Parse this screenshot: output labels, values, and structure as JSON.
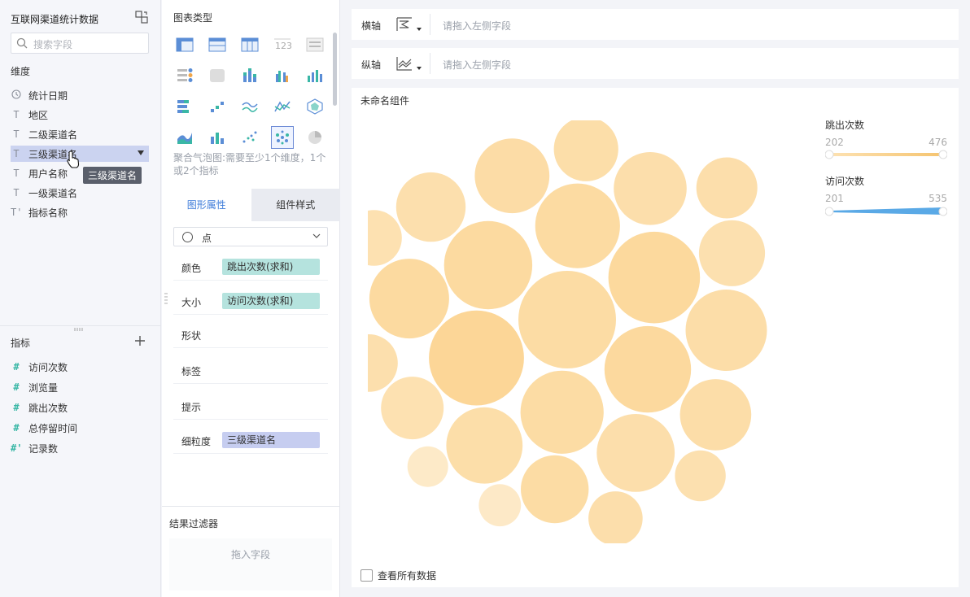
{
  "sidebar": {
    "dataset_title": "互联网渠道统计数据",
    "search_placeholder": "搜索字段",
    "dimensions_label": "维度",
    "dimensions": [
      {
        "icon": "clock",
        "label": "统计日期"
      },
      {
        "icon": "T",
        "label": "地区"
      },
      {
        "icon": "T",
        "label": "二级渠道名"
      },
      {
        "icon": "T",
        "label": "三级渠道名"
      },
      {
        "icon": "T",
        "label": "用户名称"
      },
      {
        "icon": "T",
        "label": "一级渠道名"
      },
      {
        "icon": "T'",
        "label": "指标名称"
      }
    ],
    "tooltip": "三级渠道名",
    "metrics_label": "指标",
    "metrics": [
      {
        "icon": "#",
        "label": "访问次数"
      },
      {
        "icon": "#",
        "label": "浏览量"
      },
      {
        "icon": "#",
        "label": "跳出次数"
      },
      {
        "icon": "#",
        "label": "总停留时间"
      },
      {
        "icon": "#'",
        "label": "记录数"
      }
    ]
  },
  "config": {
    "chart_type_label": "图表类型",
    "hint": "聚合气泡图:需要至少1个维度，1个或2个指标",
    "tabs": [
      "图形属性",
      "组件样式"
    ],
    "shape_value": "点",
    "props": [
      {
        "label": "颜色",
        "pill": "跳出次数(求和)"
      },
      {
        "label": "大小",
        "pill": "访问次数(求和)"
      },
      {
        "label": "形状",
        "pill": ""
      },
      {
        "label": "标签",
        "pill": ""
      },
      {
        "label": "提示",
        "pill": ""
      },
      {
        "label": "细粒度",
        "pill": "三级渠道名"
      }
    ],
    "filter_label": "结果过滤器",
    "filter_placeholder": "拖入字段"
  },
  "axes": {
    "x_label": "横轴",
    "y_label": "纵轴",
    "placeholder": "请拖入左侧字段"
  },
  "chart": {
    "component_title": "未命名组件",
    "legend_color_title": "跳出次数",
    "legend_color_min": "202",
    "legend_color_max": "476",
    "legend_size_title": "访问次数",
    "legend_size_min": "201",
    "legend_size_max": "535",
    "show_all_label": "查看所有数据",
    "colors": {
      "bubble": "#fdd9a0",
      "size_bar": "#5aa9e6"
    }
  },
  "chart_data": {
    "type": "scatter",
    "bubbles": [
      {
        "size": 535,
        "color": 400
      },
      {
        "size": 520,
        "color": 470
      },
      {
        "size": 500,
        "color": 440
      },
      {
        "size": 480,
        "color": 420
      },
      {
        "size": 470,
        "color": 430
      },
      {
        "size": 460,
        "color": 410
      },
      {
        "size": 450,
        "color": 400
      },
      {
        "size": 440,
        "color": 380
      },
      {
        "size": 430,
        "color": 420
      },
      {
        "size": 420,
        "color": 360
      },
      {
        "size": 410,
        "color": 370
      },
      {
        "size": 400,
        "color": 390
      },
      {
        "size": 390,
        "color": 360
      },
      {
        "size": 380,
        "color": 380
      },
      {
        "size": 370,
        "color": 350
      },
      {
        "size": 360,
        "color": 400
      },
      {
        "size": 350,
        "color": 340
      },
      {
        "size": 340,
        "color": 370
      },
      {
        "size": 330,
        "color": 330
      },
      {
        "size": 320,
        "color": 360
      },
      {
        "size": 300,
        "color": 350
      },
      {
        "size": 290,
        "color": 330
      },
      {
        "size": 280,
        "color": 360
      },
      {
        "size": 260,
        "color": 340
      },
      {
        "size": 210,
        "color": 210
      },
      {
        "size": 201,
        "color": 202
      }
    ]
  }
}
